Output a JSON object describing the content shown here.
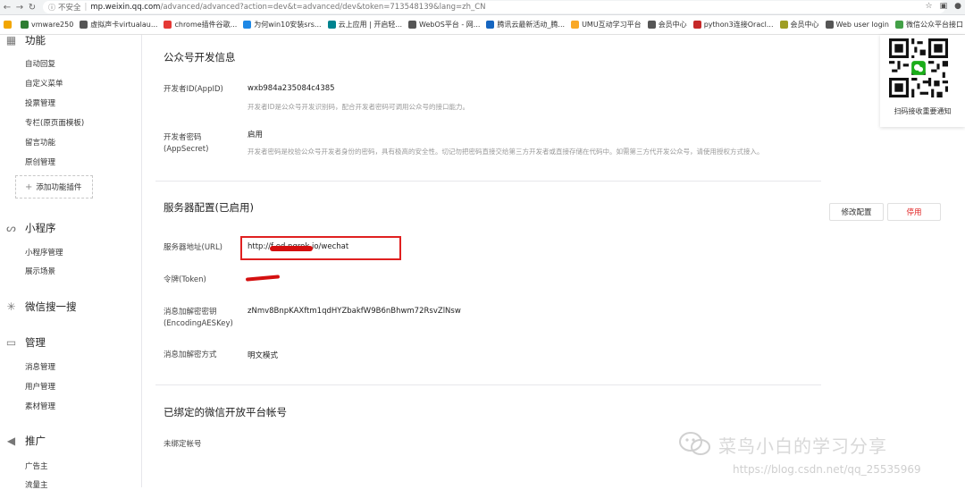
{
  "browser": {
    "security_label": "不安全",
    "host": "mp.weixin.qq.com",
    "path": "/advanced/advanced?action=dev&t=advanced/dev&token=713548139&lang=zh_CN",
    "bookmarks": [
      {
        "label": "vmware250",
        "color": "#2e7d32"
      },
      {
        "label": "虚拟声卡virtualau...",
        "color": "#555555"
      },
      {
        "label": "chrome插件谷歌...",
        "color": "#e53935"
      },
      {
        "label": "为何win10安装srs...",
        "color": "#1e88e5"
      },
      {
        "label": "云上应用 | 开启轻...",
        "color": "#00838f"
      },
      {
        "label": "WebOS平台 - 网...",
        "color": "#555555"
      },
      {
        "label": "腾讯云最新活动_腾...",
        "color": "#1565c0"
      },
      {
        "label": "UMU互动学习平台",
        "color": "#f9a825"
      },
      {
        "label": "会员中心",
        "color": "#555555"
      },
      {
        "label": "python3连接Oracl...",
        "color": "#c62828"
      },
      {
        "label": "会员中心",
        "color": "#9e9d24"
      },
      {
        "label": "Web user login",
        "color": "#555555"
      },
      {
        "label": "微信公众平台接口",
        "color": "#43a047"
      }
    ]
  },
  "sidebar": {
    "section_func": "功能",
    "func_items": [
      "自动回复",
      "自定义菜单",
      "投票管理",
      "专栏(原页面模板)",
      "留言功能",
      "原创管理"
    ],
    "add_plugin": "添加功能插件",
    "section_mini": "小程序",
    "mini_items": [
      "小程序管理",
      "展示场景"
    ],
    "section_search": "微信搜一搜",
    "section_manage": "管理",
    "manage_items": [
      "消息管理",
      "用户管理",
      "素材管理"
    ],
    "section_promo": "推广",
    "promo_items": [
      "广告主",
      "流量主"
    ]
  },
  "dev_info": {
    "title": "公众号开发信息",
    "appid_label": "开发者ID(AppID)",
    "appid_value": "wxb984a235084c4385",
    "appid_desc": "开发者ID是公众号开发识别码，配合开发者密码可调用公众号的接口能力。",
    "secret_label": "开发者密码(AppSecret)",
    "secret_value": "启用",
    "secret_desc": "开发者密码是校验公众号开发者身份的密码，具有极高的安全性。切记勿把密码直接交给第三方开发者或直接存储在代码中。如需第三方代开发公众号，请使用授权方式接入。"
  },
  "server": {
    "title": "服务器配置(已启用)",
    "edit_button": "修改配置",
    "disable_button": "停用",
    "url_label": "服务器地址(URL)",
    "url_value": "http://f          ed.ngrok.io/wechat",
    "token_label": "令牌(Token)",
    "aeskey_label": "消息加解密密钥(EncodingAESKey)",
    "aeskey_value": "zNmv8BnpKAXftm1qdHYZbakfW9B6nBhwm72RsvZlNsw",
    "mode_label": "消息加解密方式",
    "mode_value": "明文模式"
  },
  "bound": {
    "title": "已绑定的微信开放平台帐号",
    "value": "未绑定帐号"
  },
  "qr_card": {
    "caption": "扫码接收重要通知"
  },
  "watermark": {
    "text": "菜鸟小白的学习分享",
    "url": "https://blog.csdn.net/qq_25535969"
  },
  "colors": {
    "accent_red": "#e02020",
    "wechat_green": "#1aad19"
  }
}
